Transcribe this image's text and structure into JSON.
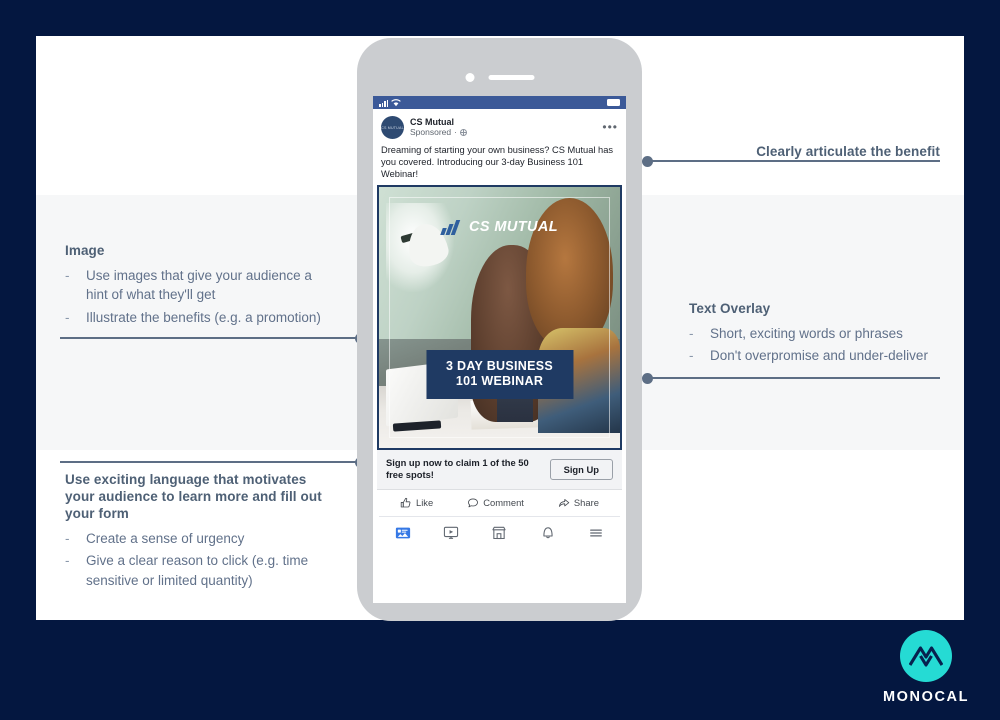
{
  "theme": {
    "page_background": "#041740",
    "panel_background": "#ffffff",
    "band_background": "#f6f7f8",
    "annotation_text": "#61718a",
    "annotation_heading": "#4e6075",
    "connector": "#5d6e85",
    "brand_accent": "#25dbd4",
    "fb_blue": "#3b5998",
    "overlay_navy": "#1f3a63"
  },
  "annotations": {
    "image": {
      "heading": "Image",
      "bullets": [
        "Use images that give your audience a hint of what they'll get",
        "Illustrate the benefits (e.g. a promotion)"
      ]
    },
    "language": {
      "heading": "Use exciting language that motivates your audience to learn more and fill out your form",
      "bullets": [
        "Create a sense of urgency",
        "Give a clear reason to click (e.g. time sensitive or limited quantity)"
      ]
    },
    "benefit": {
      "heading": "Clearly articulate the benefit",
      "bullets": []
    },
    "text_overlay": {
      "heading": "Text Overlay",
      "bullets": [
        "Short, exciting words or phrases",
        "Don't overpromise and under-deliver"
      ]
    },
    "bullet_dash": "-"
  },
  "phone": {
    "status_bar": {
      "signal_icon": "signal-bars-icon",
      "wifi_icon": "wifi-icon",
      "battery_icon": "battery-icon"
    },
    "post": {
      "avatar_icon": "cs-mutual-avatar",
      "avatar_mark_text": "CS MUTUAL",
      "page_name": "CS Mutual",
      "sponsored_label": "Sponsored",
      "separator": "·",
      "audience_icon": "globe-icon",
      "more_icon": "ellipsis-icon",
      "more_label": "•••",
      "body": "Dreaming of starting your own business? CS Mutual has you covered. Introducing our 3-day Business 101 Webinar!"
    },
    "creative": {
      "brand_name": "CS MUTUAL",
      "brand_mark_icon": "cs-mutual-chevron-mark",
      "overlay_line1": "3 DAY BUSINESS",
      "overlay_line2": "101 WEBINAR",
      "photo_alt": "two people working at a desk with laptop"
    },
    "cta": {
      "text": "Sign up now to claim 1 of the 50 free spots!",
      "button_label": "Sign Up"
    },
    "actions": [
      {
        "label": "Like",
        "icon": "thumbs-up-icon"
      },
      {
        "label": "Comment",
        "icon": "comment-bubble-icon"
      },
      {
        "label": "Share",
        "icon": "share-arrow-icon"
      }
    ],
    "navbar": [
      {
        "icon": "news-feed-icon",
        "active": true
      },
      {
        "icon": "video-icon",
        "active": false
      },
      {
        "icon": "marketplace-icon",
        "active": false
      },
      {
        "icon": "notifications-bell-icon",
        "active": false
      },
      {
        "icon": "hamburger-menu-icon",
        "active": false
      }
    ]
  },
  "logo": {
    "mark_icon": "monocal-mountain-icon",
    "wordmark": "MONOCAL"
  }
}
